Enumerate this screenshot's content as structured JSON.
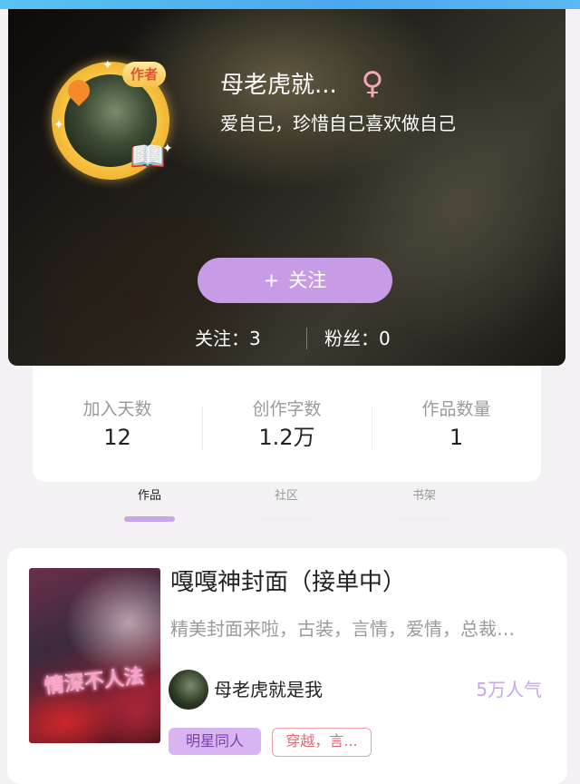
{
  "profile": {
    "avatar_badge": "作者",
    "username": "母老虎就...",
    "gender_symbol": "♀",
    "motto": "爱自己，珍惜自己喜欢做自己",
    "follow_button": {
      "plus": "+",
      "label": "关注"
    },
    "following": "关注：3",
    "fans": "粉丝：0"
  },
  "stats": [
    {
      "label": "加入天数",
      "value": "12"
    },
    {
      "label": "创作字数",
      "value": "1.2万"
    },
    {
      "label": "作品数量",
      "value": "1"
    }
  ],
  "tabs": [
    {
      "label": "作品",
      "active": true
    },
    {
      "label": "社区",
      "active": false
    },
    {
      "label": "书架",
      "active": false
    }
  ],
  "work": {
    "cover_text": "情深不人法",
    "title": "嘎嘎神封面（接单中）",
    "description": "精美封面来啦，古装，言情，爱情，总裁…",
    "author": "母老虎就是我",
    "popularity": "5万人气",
    "tags": [
      "明星同人",
      "穿越，言..."
    ]
  },
  "colors": {
    "accent": "#c89be6",
    "tab_active": "#c9a6e6",
    "popularity": "#c9a6e6",
    "gender": "#f4a6b4",
    "tag_outline": "#e06a70"
  },
  "icons": {
    "gender": "female-symbol-icon",
    "plus": "plus-icon"
  }
}
